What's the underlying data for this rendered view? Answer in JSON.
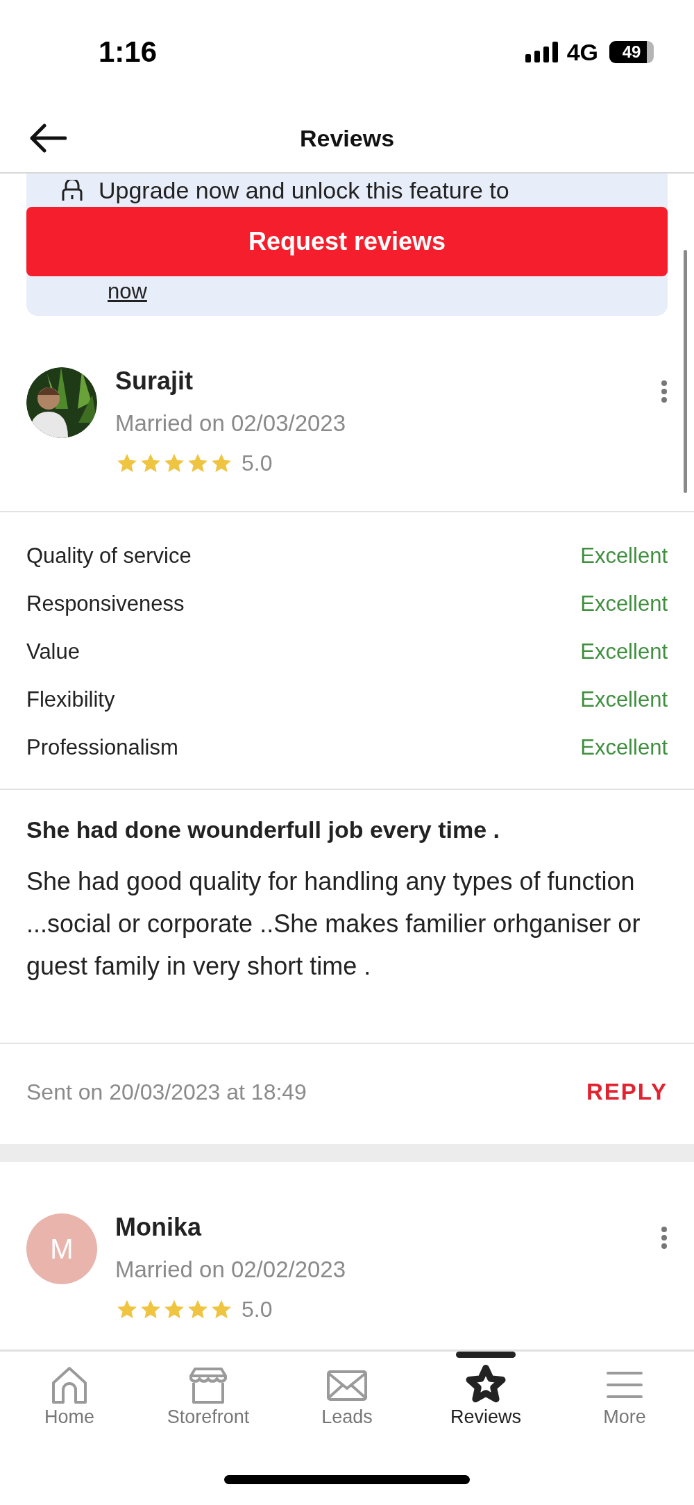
{
  "status_bar": {
    "time": "1:16",
    "network": "4G",
    "battery": "49"
  },
  "header": {
    "title": "Reviews"
  },
  "upgrade_banner": {
    "text": "Upgrade now and unlock this feature to",
    "link": "now"
  },
  "request_button": {
    "label": "Request reviews"
  },
  "reviews": [
    {
      "name": "Surajit",
      "married": "Married on 02/03/2023",
      "stars": 5,
      "rating": "5.0",
      "criteria": [
        {
          "label": "Quality of service",
          "value": "Excellent"
        },
        {
          "label": "Responsiveness",
          "value": "Excellent"
        },
        {
          "label": "Value",
          "value": "Excellent"
        },
        {
          "label": "Flexibility",
          "value": "Excellent"
        },
        {
          "label": "Professionalism",
          "value": "Excellent"
        }
      ],
      "title": "She had done wounderfull job every time .",
      "body": "She had good quality for handling any types of function ...social or corporate ..She makes familier orhganiser or guest family in very short time .",
      "sent": "Sent on 20/03/2023 at 18:49",
      "reply": "REPLY"
    },
    {
      "avatar": {
        "kind": "initial",
        "initial": "M",
        "color": "#e8b4ac"
      },
      "name": "Monika",
      "married": "Married on 02/02/2023",
      "stars": 5,
      "rating": "5.0"
    }
  ],
  "tabs": [
    {
      "label": "Home",
      "selected": false
    },
    {
      "label": "Storefront",
      "selected": false
    },
    {
      "label": "Leads",
      "selected": false
    },
    {
      "label": "Reviews",
      "selected": true
    },
    {
      "label": "More",
      "selected": false
    }
  ]
}
